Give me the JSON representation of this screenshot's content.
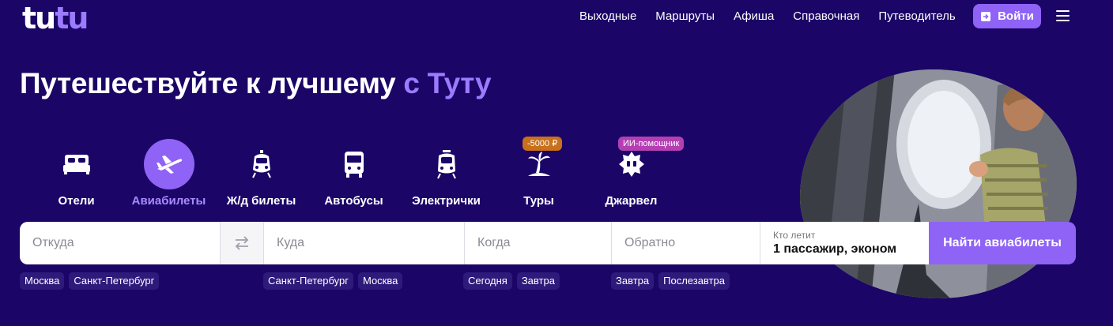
{
  "header": {
    "logo": {
      "part1": "tu",
      "part2": "tu"
    },
    "nav": [
      "Выходные",
      "Маршруты",
      "Афиша",
      "Справочная",
      "Путеводитель"
    ],
    "login_label": "Войти"
  },
  "hero": {
    "headline": "Путешествуйте к лучшему",
    "headline_accent": "с Туту"
  },
  "categories": [
    {
      "label": "Отели",
      "icon": "bed-icon"
    },
    {
      "label": "Авиабилеты",
      "icon": "airplane-icon",
      "active": true
    },
    {
      "label": "Ж/д билеты",
      "icon": "train-icon"
    },
    {
      "label": "Автобусы",
      "icon": "bus-icon"
    },
    {
      "label": "Электрички",
      "icon": "suburban-train-icon"
    },
    {
      "label": "Туры",
      "icon": "palm-icon",
      "badge": "-5000 ₽"
    },
    {
      "label": "Джарвел",
      "icon": "jarvel-icon",
      "badge": "ИИ-помощник"
    }
  ],
  "form": {
    "from_placeholder": "Откуда",
    "to_placeholder": "Куда",
    "when_placeholder": "Когда",
    "back_placeholder": "Обратно",
    "passengers_label": "Кто летит",
    "passengers_value": "1 пассажир, эконом",
    "search_button": "Найти авиабилеты"
  },
  "chips": {
    "from": [
      "Москва",
      "Санкт-Петербург"
    ],
    "to": [
      "Санкт-Петербург",
      "Москва"
    ],
    "when": [
      "Сегодня",
      "Завтра"
    ],
    "back": [
      "Завтра",
      "Послезавтра"
    ]
  },
  "colors": {
    "background": "#1b0667",
    "accent": "#8e63f5",
    "accent_text": "#9b7bff"
  }
}
